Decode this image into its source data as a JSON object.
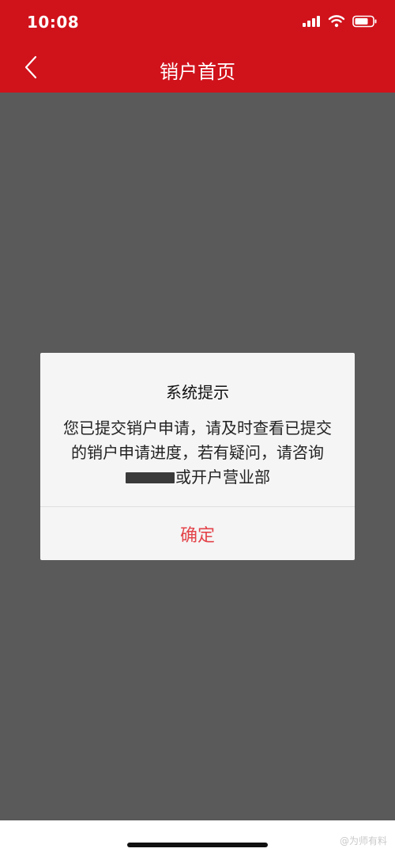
{
  "status_bar": {
    "time": "10:08",
    "icons": [
      "signal-icon",
      "wifi-icon",
      "battery-icon"
    ]
  },
  "nav": {
    "title": "销户首页",
    "back_icon": "chevron-left-icon"
  },
  "dialog": {
    "title": "系统提示",
    "message_part1": "您已提交销户申请，请及时查看已提交的销户申请进度，若有疑问，请咨询",
    "message_part2": "或开户营业部",
    "confirm_label": "确定"
  },
  "watermark": {
    "text": "@为师有料"
  },
  "colors": {
    "header": "#d0121b",
    "overlay": "#5a5a5a",
    "confirm_text": "#e3434a",
    "dialog_bg": "#f5f5f5"
  }
}
